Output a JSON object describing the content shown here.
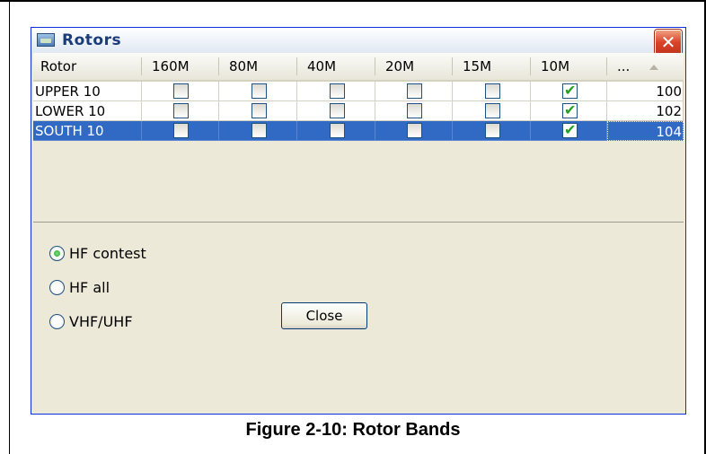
{
  "window": {
    "title": "Rotors",
    "close_glyph": "✕"
  },
  "grid": {
    "columns": [
      "Rotor",
      "160M",
      "80M",
      "40M",
      "20M",
      "15M",
      "10M",
      "..."
    ],
    "rows": [
      {
        "name": "UPPER 10",
        "bands": [
          false,
          false,
          false,
          false,
          false,
          true
        ],
        "value": "100",
        "selected": false
      },
      {
        "name": "LOWER 10",
        "bands": [
          false,
          false,
          false,
          false,
          false,
          true
        ],
        "value": "102",
        "selected": false
      },
      {
        "name": "SOUTH 10",
        "bands": [
          false,
          false,
          false,
          false,
          false,
          true
        ],
        "value": "104",
        "selected": true
      }
    ]
  },
  "options": {
    "radios": [
      {
        "label": "HF contest",
        "checked": true
      },
      {
        "label": "HF all",
        "checked": false
      },
      {
        "label": "VHF/UHF",
        "checked": false
      }
    ]
  },
  "buttons": {
    "close": "Close"
  },
  "caption": "Figure 2-10:  Rotor Bands",
  "colors": {
    "selection": "#316ac5",
    "check": "#21a121",
    "close_button": "#d9442a",
    "window_bg": "#ece9d8"
  },
  "icons": {
    "app": "rotor-app-icon",
    "check": "check-icon",
    "close": "close-icon",
    "sort": "sort-ascending-icon"
  }
}
